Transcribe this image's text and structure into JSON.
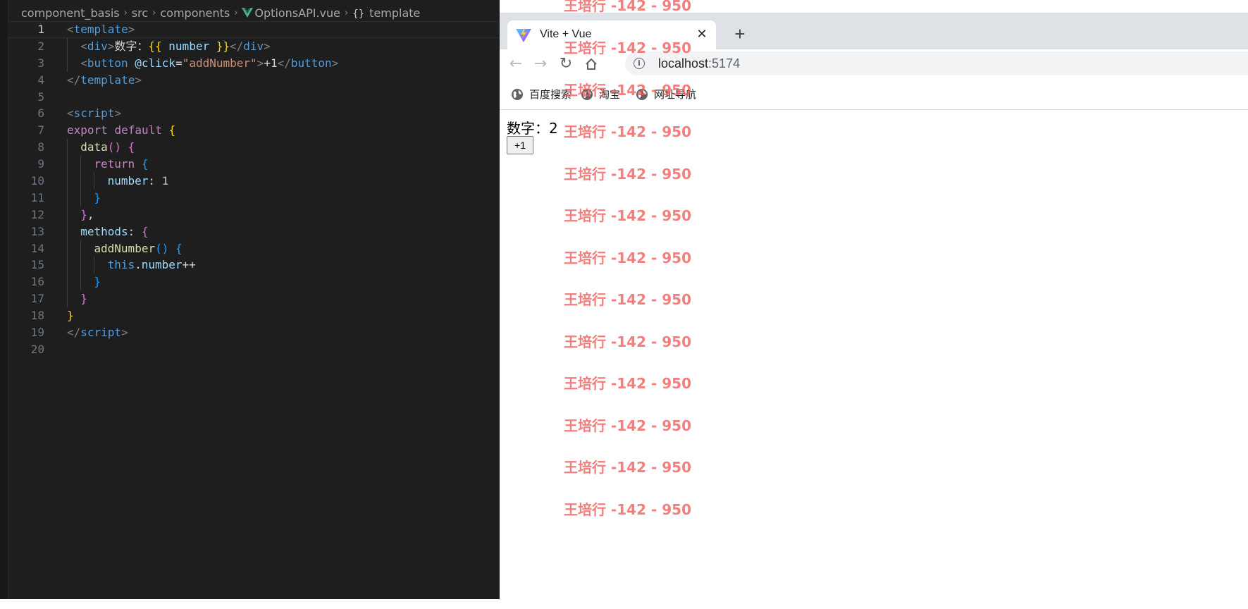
{
  "editor": {
    "breadcrumb": [
      "component_basis",
      "src",
      "components",
      "OptionsAPI.vue",
      "template"
    ],
    "current_line": 1,
    "lines": [
      {
        "n": "1"
      },
      {
        "n": "2"
      },
      {
        "n": "3"
      },
      {
        "n": "4"
      },
      {
        "n": "5"
      },
      {
        "n": "6"
      },
      {
        "n": "7"
      },
      {
        "n": "8"
      },
      {
        "n": "9"
      },
      {
        "n": "10"
      },
      {
        "n": "11"
      },
      {
        "n": "12"
      },
      {
        "n": "13"
      },
      {
        "n": "14"
      },
      {
        "n": "15"
      },
      {
        "n": "16"
      },
      {
        "n": "17"
      },
      {
        "n": "18"
      },
      {
        "n": "19"
      },
      {
        "n": "20"
      }
    ],
    "code": [
      [
        [
          "<",
          "punc"
        ],
        [
          "template",
          "tag"
        ],
        [
          ">",
          "punc"
        ]
      ],
      [
        [
          "<",
          "punc"
        ],
        [
          "div",
          "tag"
        ],
        [
          ">",
          "punc"
        ],
        [
          "数字：",
          "text"
        ],
        [
          "{{",
          "mustache"
        ],
        [
          " number ",
          "attr"
        ],
        [
          "}}",
          "mustache"
        ],
        [
          "</",
          "punc"
        ],
        [
          "div",
          "tag"
        ],
        [
          ">",
          "punc"
        ]
      ],
      [
        [
          "<",
          "punc"
        ],
        [
          "button",
          "tag"
        ],
        [
          " @click",
          "attr"
        ],
        [
          "=",
          "text"
        ],
        [
          "\"addNumber\"",
          "str"
        ],
        [
          ">",
          "punc"
        ],
        [
          "+1",
          "text"
        ],
        [
          "</",
          "punc"
        ],
        [
          "button",
          "tag"
        ],
        [
          ">",
          "punc"
        ]
      ],
      [
        [
          "</",
          "punc"
        ],
        [
          "template",
          "tag"
        ],
        [
          ">",
          "punc"
        ]
      ],
      [],
      [
        [
          "<",
          "punc"
        ],
        [
          "script",
          "tag"
        ],
        [
          ">",
          "punc"
        ]
      ],
      [
        [
          "export",
          "kw"
        ],
        [
          " ",
          "text"
        ],
        [
          "default",
          "kw"
        ],
        [
          " ",
          "text"
        ],
        [
          "{",
          "b1"
        ]
      ],
      [
        [
          "data",
          "fn"
        ],
        [
          "()",
          "b2"
        ],
        [
          " ",
          "text"
        ],
        [
          "{",
          "b2"
        ]
      ],
      [
        [
          "return",
          "kw"
        ],
        [
          " ",
          "text"
        ],
        [
          "{",
          "b3"
        ]
      ],
      [
        [
          "number",
          "attr"
        ],
        [
          ": ",
          "text"
        ],
        [
          "1",
          "num"
        ]
      ],
      [
        [
          "}",
          "b3"
        ]
      ],
      [
        [
          "}",
          "b2"
        ],
        [
          ",",
          "text"
        ]
      ],
      [
        [
          "methods",
          "attr"
        ],
        [
          ": ",
          "text"
        ],
        [
          "{",
          "b2"
        ]
      ],
      [
        [
          "addNumber",
          "fn"
        ],
        [
          "()",
          "b3"
        ],
        [
          " ",
          "text"
        ],
        [
          "{",
          "b3"
        ]
      ],
      [
        [
          "this",
          "this"
        ],
        [
          ".",
          "text"
        ],
        [
          "number",
          "attr"
        ],
        [
          "++",
          "text"
        ]
      ],
      [
        [
          "}",
          "b3"
        ]
      ],
      [
        [
          "}",
          "b2"
        ]
      ],
      [
        [
          "}",
          "b1"
        ]
      ],
      [
        [
          "</",
          "punc"
        ],
        [
          "script",
          "tag"
        ],
        [
          ">",
          "punc"
        ]
      ],
      []
    ]
  },
  "browser": {
    "tab_title": "Vite + Vue",
    "tab_close": "✕",
    "new_tab": "+",
    "url_host": "localhost",
    "url_port": ":5174",
    "info_icon": "i",
    "bookmarks": [
      "百度搜索",
      "淘宝",
      "网址导航"
    ],
    "page": {
      "counter_label": "数字：",
      "counter_value": "2",
      "button_label": "+1"
    }
  },
  "watermark": "王培行 -142 - 950",
  "colors": {
    "editor_bg": "#1e1e1e",
    "browser_tabstrip": "#dee1e6",
    "watermark": "#f05a5a"
  }
}
